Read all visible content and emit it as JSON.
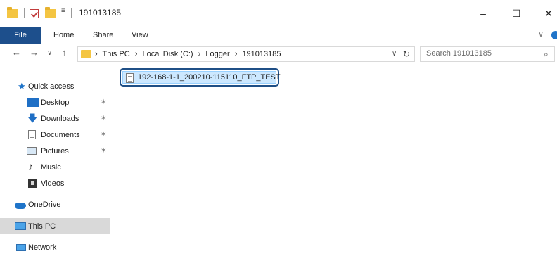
{
  "window": {
    "title": "191013185",
    "minimize_glyph": "–",
    "maximize_glyph": "☐",
    "close_glyph": "✕"
  },
  "quick_access_toolbar": {
    "dropdown_glyph": "≡"
  },
  "ribbon": {
    "tabs": [
      {
        "label": "File"
      },
      {
        "label": "Home"
      },
      {
        "label": "Share"
      },
      {
        "label": "View"
      }
    ],
    "expand_glyph": "∨",
    "accent_color": "#1d4f8c"
  },
  "address_bar": {
    "back_glyph": "←",
    "forward_glyph": "→",
    "recent_glyph": "∨",
    "up_glyph": "↑",
    "separator": "›",
    "breadcrumbs": [
      "This PC",
      "Local Disk (C:)",
      "Logger",
      "191013185"
    ],
    "dropdown_glyph": "∨",
    "refresh_glyph": "↻"
  },
  "search": {
    "placeholder": "Search 191013185",
    "icon_glyph": "⌕"
  },
  "sidebar": {
    "items": [
      {
        "label": "Quick access",
        "icon": "star-icon"
      },
      {
        "label": "Desktop",
        "icon": "desktop-icon",
        "pinned": true
      },
      {
        "label": "Downloads",
        "icon": "download-icon",
        "pinned": true
      },
      {
        "label": "Documents",
        "icon": "documents-icon",
        "pinned": true
      },
      {
        "label": "Pictures",
        "icon": "pictures-icon",
        "pinned": true
      },
      {
        "label": "Music",
        "icon": "music-icon"
      },
      {
        "label": "Videos",
        "icon": "videos-icon"
      },
      {
        "label": "OneDrive",
        "icon": "cloud-icon"
      },
      {
        "label": "This PC",
        "icon": "computer-icon",
        "selected": true
      },
      {
        "label": "Network",
        "icon": "network-icon"
      }
    ],
    "pin_glyph": "✶",
    "selected_color": "#d9d9d9"
  },
  "content": {
    "files": [
      {
        "name": "192-168-1-1_200210-115110_FTP_TEST",
        "icon": "file-icon",
        "selected": true
      }
    ],
    "selection_color": "#cce8ff",
    "highlight_border_color": "#1f4f86"
  }
}
